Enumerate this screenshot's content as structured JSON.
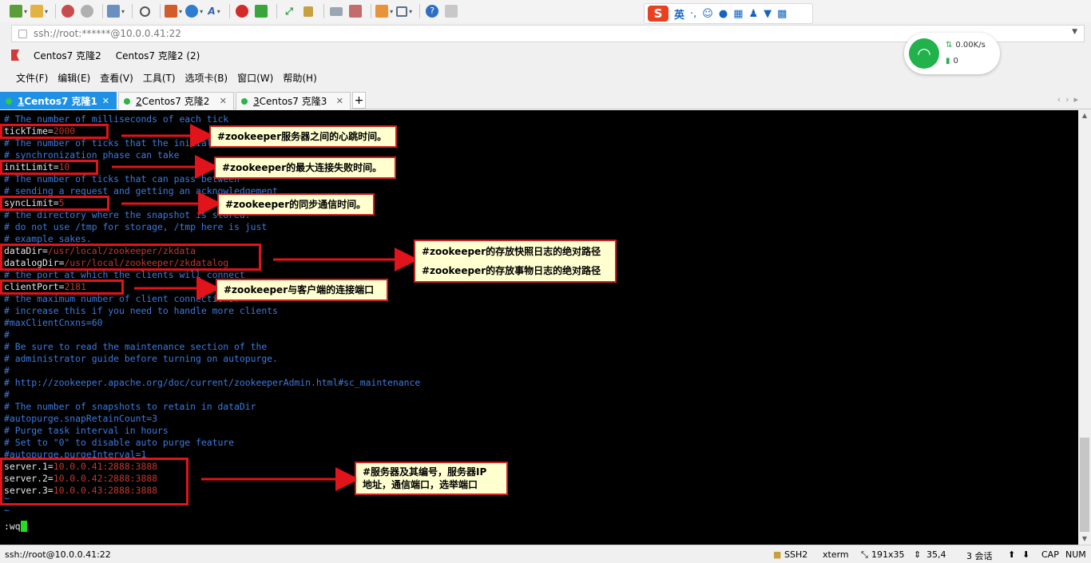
{
  "toolbar": {
    "items": [
      "new-session-icon",
      "open-folder-icon",
      "disconnect-icon",
      "reconnect-icon",
      "new-tab-icon",
      "find-icon",
      "transfer-icon",
      "globe-icon",
      "font-icon",
      "logo-icon",
      "xftp-icon",
      "fullscreen-icon",
      "lock-icon",
      "keyboard-icon",
      "script-icon",
      "add-icon",
      "layout-icon",
      "help-icon",
      "chat-icon"
    ]
  },
  "ime": {
    "logo": "S",
    "lang": "英",
    "punct": "·,"
  },
  "address": {
    "value": "ssh://root:******@10.0.0.41:22"
  },
  "bookmarks": [
    {
      "label": "Centos7 克隆2"
    },
    {
      "label": "Centos7 克隆2 (2)"
    }
  ],
  "network": {
    "speed": "0.00K/s",
    "count": "0"
  },
  "menu": [
    "文件(F)",
    "编辑(E)",
    "查看(V)",
    "工具(T)",
    "选项卡(B)",
    "窗口(W)",
    "帮助(H)"
  ],
  "tabs": [
    {
      "num": "1",
      "label": "Centos7 克隆1",
      "active": true
    },
    {
      "num": "2",
      "label": "Centos7 克隆2",
      "active": false
    },
    {
      "num": "3",
      "label": "Centos7 克隆3",
      "active": false
    }
  ],
  "terminal": {
    "lines": [
      {
        "key": "",
        "value": "# The number of milliseconds of each tick"
      },
      {
        "key": "tickTime=",
        "value": "2000"
      },
      {
        "key": "",
        "value": "# The number of ticks that the initial"
      },
      {
        "key": "",
        "value": "# synchronization phase can take"
      },
      {
        "key": "initLimit=",
        "value": "10"
      },
      {
        "key": "",
        "value": "# The number of ticks that can pass between"
      },
      {
        "key": "",
        "value": "# sending a request and getting an acknowledgement"
      },
      {
        "key": "syncLimit=",
        "value": "5"
      },
      {
        "key": "",
        "value": "# the directory where the snapshot is stored."
      },
      {
        "key": "",
        "value": "# do not use /tmp for storage, /tmp here is just"
      },
      {
        "key": "",
        "value": "# example sakes."
      },
      {
        "key": "dataDir=",
        "value": "/usr/local/zookeeper/zkdata"
      },
      {
        "key": "datalogDir=",
        "value": "/usr/local/zookeeper/zkdatalog"
      },
      {
        "key": "",
        "value": "# the port at which the clients will connect"
      },
      {
        "key": "clientPort=",
        "value": "2181"
      },
      {
        "key": "",
        "value": "# the maximum number of client connections."
      },
      {
        "key": "",
        "value": "# increase this if you need to handle more clients"
      },
      {
        "key": "",
        "value": "#maxClientCnxns=60"
      },
      {
        "key": "",
        "value": "#"
      },
      {
        "key": "",
        "value": "# Be sure to read the maintenance section of the"
      },
      {
        "key": "",
        "value": "# administrator guide before turning on autopurge."
      },
      {
        "key": "",
        "value": "#"
      },
      {
        "key": "",
        "value": "# http://zookeeper.apache.org/doc/current/zookeeperAdmin.html#sc_maintenance"
      },
      {
        "key": "",
        "value": "#"
      },
      {
        "key": "",
        "value": "# The number of snapshots to retain in dataDir"
      },
      {
        "key": "",
        "value": "#autopurge.snapRetainCount=3"
      },
      {
        "key": "",
        "value": "# Purge task interval in hours"
      },
      {
        "key": "",
        "value": "# Set to \"0\" to disable auto purge feature"
      },
      {
        "key": "",
        "value": "#autopurge.purgeInterval=1"
      },
      {
        "key": "server.1=",
        "value": "10.0.0.41:2888:3888"
      },
      {
        "key": "server.2=",
        "value": "10.0.0.42:2888:3888"
      },
      {
        "key": "server.3=",
        "value": "10.0.0.43:2888:3888"
      },
      {
        "key": "",
        "value": "~"
      },
      {
        "key": "",
        "value": "~"
      },
      {
        "key": "",
        "value": ":wq"
      }
    ]
  },
  "annotations": {
    "tick": "#zookeeper服务器之间的心跳时间。",
    "init": "#zookeeper的最大连接失败时间。",
    "sync": "#zookeeper的同步通信时间。",
    "dirs_1": "#zookeeper的存放快照日志的绝对路径",
    "dirs_2": "#zookeeper的存放事物日志的绝对路径",
    "port": "#zookeeper与客户端的连接端口",
    "servers_1": "#服务器及其编号，服务器IP",
    "servers_2": "地址，通信端口，选举端口"
  },
  "status": {
    "host": "ssh://root@10.0.0.41:22",
    "protocol": "SSH2",
    "term": "xterm",
    "size": "191x35",
    "pos": "35,4",
    "sessions": "3 会话",
    "cap": "CAP",
    "num": "NUM"
  },
  "colors": {
    "tab_active": "#1e90e6",
    "comment": "#3a7be0",
    "value": "#c0392b",
    "annotation_border": "#e0141a",
    "cursor": "#22dd22"
  }
}
